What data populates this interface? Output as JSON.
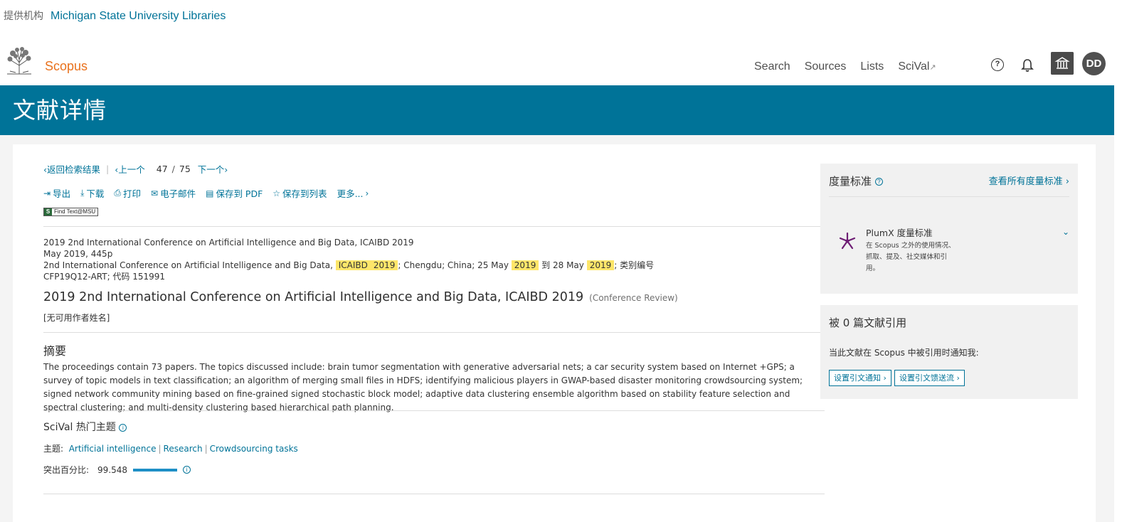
{
  "institution": {
    "label": "提供机构",
    "name": "Michigan State University Libraries"
  },
  "header": {
    "brand": "Scopus",
    "nav": [
      "Search",
      "Sources",
      "Lists",
      "SciVal"
    ],
    "scival_ext": "↗",
    "help_glyph": "?",
    "avatar": "DD"
  },
  "banner": {
    "title": "文献详情"
  },
  "navigation": {
    "back": "返回检索结果",
    "prev": "上一个",
    "current": "47",
    "divider": "/",
    "total": "75",
    "next": "下一个"
  },
  "toolbar": {
    "export": "导出",
    "download": "下载",
    "print": "打印",
    "email": "电子邮件",
    "save_pdf": "保存到 PDF",
    "save_list": "保存到列表",
    "more": "更多..."
  },
  "find_text": "Find Text@MSU",
  "source": {
    "line1": "2019 2nd International Conference on Artificial Intelligence and Big Data, ICAIBD 2019",
    "line2": "May 2019, 445p",
    "line3_a": "2nd International Conference on Artificial Intelligence and Big Data,",
    "hl1": "ICAIBD",
    "hl2": "2019",
    "line3_b": "; Chengdu; China; 25 May",
    "hl3": "2019",
    "line3_c": "到 28 May",
    "hl4": "2019",
    "line3_d": "; 类别编号CFP19Q12-ART; 代码 151991"
  },
  "doc": {
    "title": "2019 2nd International Conference on Artificial Intelligence and Big Data, ICAIBD 2019",
    "type": "(Conference Review)",
    "author": "[无可用作者姓名]"
  },
  "abstract": {
    "heading": "摘要",
    "text": "The proceedings contain 73 papers. The topics discussed include: brain tumor segmentation with generative adversarial nets; a car security system based on Internet +GPS; a survey of topic models in text classification; an algorithm of merging small files in HDFS; identifying malicious players in GWAP-based disaster monitoring crowdsourcing system; signed network community mining based on fine-grained signed stochastic block model; adaptive data clustering ensemble algorithm based on stability feature selection and spectral clustering; and multi-density clustering based hierarchical path planning."
  },
  "scival": {
    "heading": "SciVal 热门主题",
    "info_glyph": "i",
    "topic_label": "主题:",
    "topics": [
      "Artificial intelligence",
      "Research",
      "Crowdsourcing tasks"
    ],
    "topic_sep": "|",
    "percentile_label": "突出百分比:",
    "percentile": "99.548",
    "percentile_fraction": 0.995
  },
  "metrics": {
    "heading": "度量标准",
    "view_all": "查看所有度量标准",
    "info_glyph": "?",
    "plumx_title": "PlumX 度量标准",
    "plumx_desc": "在 Scopus 之外的使用情况、抓取、提及、社交媒体和引用。"
  },
  "cited": {
    "heading": "被 0 篇文献引用",
    "notify": "当此文献在 Scopus 中被引用时通知我:",
    "btn_alert": "设置引文通知",
    "btn_feed": "设置引文馈送流"
  },
  "colors": {
    "accent": "#007398",
    "brand": "#e9711c",
    "highlight": "#fde66a",
    "plumx": "#6e1e74"
  }
}
